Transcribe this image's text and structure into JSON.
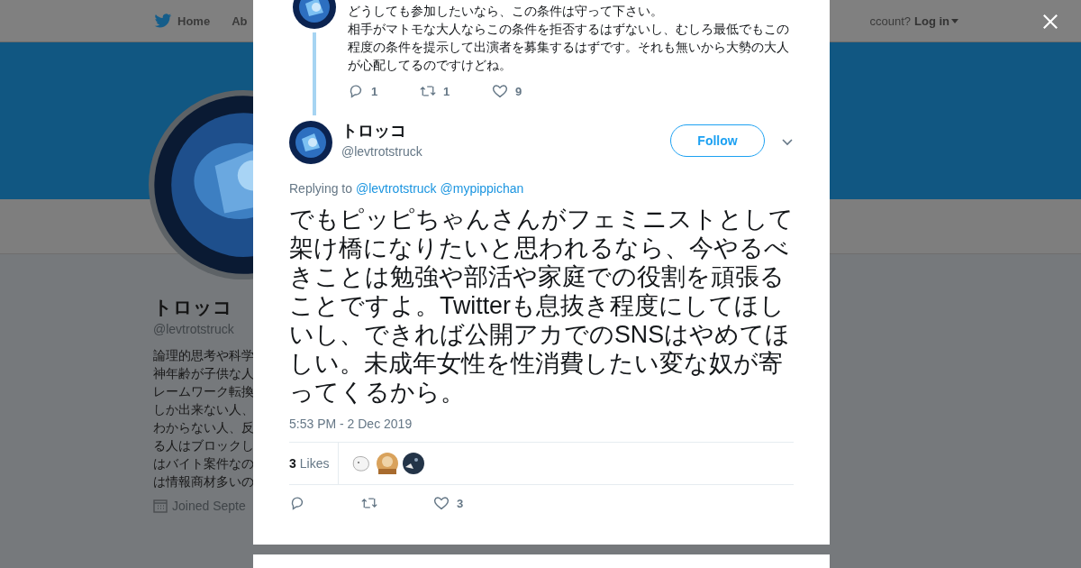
{
  "nav": {
    "home": "Home",
    "about": "Ab",
    "login_prompt": "ccount?",
    "login": "Log in"
  },
  "profile": {
    "name": "トロッコ",
    "handle": "@levtrotstruck",
    "bio_lines": [
      "論理的思考や科学",
      "神年齢が子供な人",
      "レームワーク転換",
      "しか出来ない人、",
      "わからない人、反",
      "る人はブロックし",
      "はバイト案件なの",
      "は情報商材多いの"
    ],
    "joined": "Joined Septe"
  },
  "parent_tweet": {
    "paragraphs": [
      "どうしても参加したいなら、この条件は守って下さい。",
      "相手がマトモな大人ならこの条件を拒否するはずないし、むしろ最低でもこの程度の条件を提示して出演者を募集するはずです。それも無いから大勢の大人が心配してるのですけどね。"
    ],
    "replies": "1",
    "retweets": "1",
    "likes": "9"
  },
  "tweet": {
    "name": "トロッコ",
    "handle": "@levtrotstruck",
    "follow": "Follow",
    "replying_label": "Replying to",
    "replying_to": [
      "@levtrotstruck",
      "@mypippichan"
    ],
    "text": "でもピッピちゃんさんがフェミニストとして架け橋になりたいと思われるなら、今やるべきことは勉強や部活や家庭での役割を頑張ることですよ。Twitterも息抜き程度にしてほしいし、できれば公開アカでのSNSはやめてほしい。未成年女性を性消費したい変な奴が寄ってくるから。",
    "time": "5:53 PM - 2 Dec 2019",
    "likes_count": "3",
    "likes_label": "Likes",
    "like_action_count": "3"
  }
}
